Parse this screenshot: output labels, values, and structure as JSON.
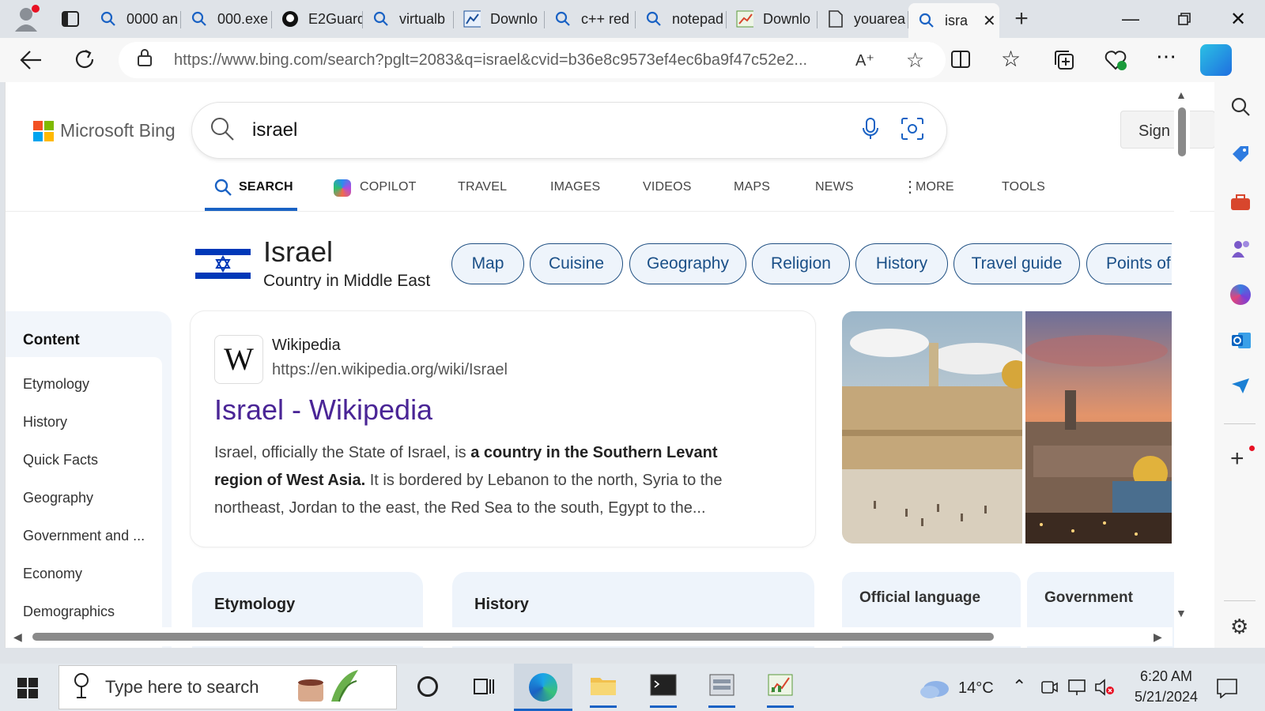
{
  "tabs": [
    {
      "label": "0000 an",
      "icon": "search-icon"
    },
    {
      "label": "000.exe",
      "icon": "search-icon"
    },
    {
      "label": "E2Guard",
      "icon": "github-icon"
    },
    {
      "label": "virtualb",
      "icon": "search-icon"
    },
    {
      "label": "Downlo",
      "icon": "chart-app-icon"
    },
    {
      "label": "c++ red",
      "icon": "search-icon"
    },
    {
      "label": "notepad",
      "icon": "search-icon"
    },
    {
      "label": "Downlo",
      "icon": "spreadsheet-icon"
    },
    {
      "label": "youarea",
      "icon": "page-icon"
    },
    {
      "label": "isra",
      "icon": "search-icon"
    }
  ],
  "address": {
    "url": "https://www.bing.com/search?pglt=2083&q=israel&cvid=b36e8c9573ef4ec6ba9f47c52e2..."
  },
  "header": {
    "logo": "Microsoft Bing",
    "query": "israel",
    "sign_in": "Sign"
  },
  "nav": [
    "SEARCH",
    "COPILOT",
    "TRAVEL",
    "IMAGES",
    "VIDEOS",
    "MAPS",
    "NEWS",
    "MORE",
    "TOOLS"
  ],
  "entity": {
    "title": "Israel",
    "subtitle": "Country in Middle East"
  },
  "chips": [
    "Map",
    "Cuisine",
    "Geography",
    "Religion",
    "History",
    "Travel guide",
    "Points of"
  ],
  "content": {
    "heading": "Content",
    "items": [
      "Etymology",
      "History",
      "Quick Facts",
      "Geography",
      "Government and ...",
      "Economy",
      "Demographics"
    ]
  },
  "result": {
    "source": "Wikipedia",
    "url": "https://en.wikipedia.org/wiki/Israel",
    "title": "Israel - Wikipedia",
    "snippet_1": "Israel, officially the State of Israel, is ",
    "snippet_bold": "a country in the Southern Levant region of West Asia.",
    "snippet_2": " It is bordered by Lebanon to the north, Syria to the northeast, Jordan to the east, the Red Sea to the south, Egypt to the..."
  },
  "cards": {
    "etymology": "Etymology",
    "history": "History",
    "official_language": "Official language",
    "government": "Government"
  },
  "taskbar": {
    "search_placeholder": "Type here to search",
    "temperature": "14°C",
    "time": "6:20 AM",
    "date": "5/21/2024"
  },
  "colors": {
    "link": "#4a2596",
    "chip_border": "#1f4f82",
    "accent": "#1a62c4"
  }
}
